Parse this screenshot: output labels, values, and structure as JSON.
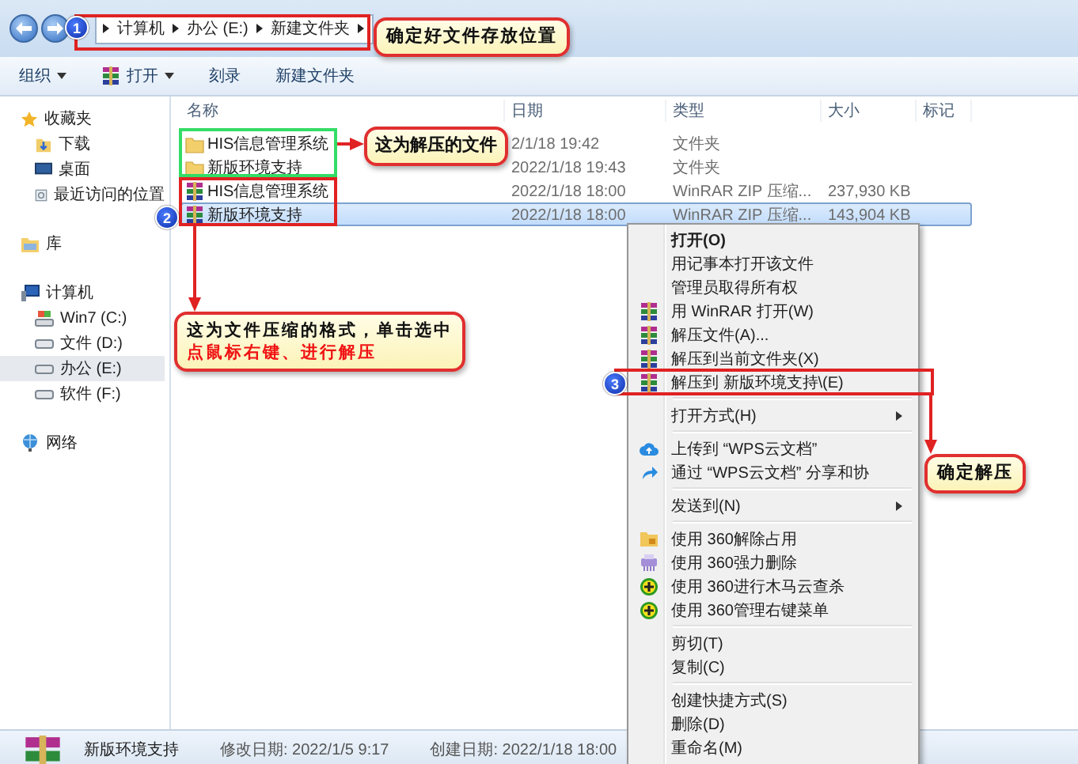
{
  "address_bar": {
    "path": [
      "计算机",
      "办公 (E:)",
      "新建文件夹"
    ]
  },
  "toolbar": [
    {
      "label": "组织",
      "dropdown": true
    },
    {
      "label": "打开",
      "dropdown": true
    },
    {
      "label": "刻录",
      "dropdown": false
    },
    {
      "label": "新建文件夹",
      "dropdown": false
    }
  ],
  "sidebar": {
    "items": [
      {
        "label": "收藏夹",
        "selected": false,
        "children": [
          {
            "label": "下载",
            "selected": false
          },
          {
            "label": "桌面",
            "selected": false
          },
          {
            "label": "最近访问的位置",
            "selected": false
          }
        ]
      },
      {
        "label": "库",
        "selected": false
      },
      {
        "label": "计算机",
        "selected": false,
        "children": [
          {
            "label": "Win7 (C:)",
            "selected": false
          },
          {
            "label": "文件 (D:)",
            "selected": false
          },
          {
            "label": "办公 (E:)",
            "selected": true
          },
          {
            "label": "软件 (F:)",
            "selected": false
          }
        ]
      },
      {
        "label": "网络",
        "selected": false
      }
    ]
  },
  "file_list": {
    "columns": [
      "名称",
      "日期",
      "类型",
      "大小",
      "标记"
    ],
    "rows": [
      {
        "name": "HIS信息管理系统",
        "kind": "folder",
        "date": "2/1/18 19:42",
        "type": "文件夹",
        "selected": false
      },
      {
        "name": "新版环境支持",
        "kind": "folder",
        "date": "2022/1/18 19:43",
        "type": "文件夹",
        "selected": false
      },
      {
        "name": "HIS信息管理系统",
        "kind": "archive",
        "date": "2022/1/18 18:00",
        "type": "WinRAR ZIP 压缩...",
        "size": "237,930 KB",
        "selected": false
      },
      {
        "name": "新版环境支持",
        "kind": "archive",
        "date": "2022/1/18 18:00",
        "type": "WinRAR ZIP 压缩...",
        "size": "143,904 KB",
        "selected": true
      }
    ]
  },
  "context_menu": {
    "groups": [
      [
        {
          "label": "打开(O)",
          "default": true,
          "submenu": false
        },
        {
          "label": "用记事本打开该文件",
          "default": false,
          "submenu": false
        },
        {
          "label": "管理员取得所有权",
          "default": false,
          "submenu": false
        },
        {
          "label": "用 WinRAR 打开(W)",
          "default": false,
          "submenu": false
        },
        {
          "label": "解压文件(A)...",
          "default": false,
          "submenu": false
        },
        {
          "label": "解压到当前文件夹(X)",
          "default": false,
          "submenu": false
        },
        {
          "label": "解压到 新版环境支持\\(E)",
          "default": false,
          "submenu": false
        }
      ],
      [
        {
          "label": "打开方式(H)",
          "default": false,
          "submenu": true
        }
      ],
      [
        {
          "label": "上传到 “WPS云文档”",
          "default": false,
          "submenu": false
        },
        {
          "label": "通过 “WPS云文档” 分享和协",
          "default": false
        }
      ],
      [
        {
          "label": "发送到(N)",
          "default": false,
          "submenu": true
        }
      ],
      [
        {
          "label": "使用 360解除占用",
          "default": false,
          "submenu": false
        },
        {
          "label": "使用 360强力删除",
          "default": false,
          "submenu": false
        },
        {
          "label": "使用 360进行木马云查杀",
          "default": false,
          "submenu": false
        },
        {
          "label": "使用 360管理右键菜单",
          "default": false,
          "submenu": false
        }
      ],
      [
        {
          "label": "剪切(T)",
          "default": false,
          "submenu": false
        },
        {
          "label": "复制(C)",
          "default": false,
          "submenu": false
        }
      ],
      [
        {
          "label": "创建快捷方式(S)",
          "default": false,
          "submenu": false
        },
        {
          "label": "删除(D)",
          "default": false,
          "submenu": false
        },
        {
          "label": "重命名(M)",
          "default": false,
          "submenu": false
        }
      ]
    ]
  },
  "details_pane": {
    "name": "新版环境支持",
    "modified": "修改日期: 2022/1/5 9:17",
    "created": "创建日期: 2022/1/18 18:00"
  },
  "annotations": {
    "badges": [
      "1",
      "2",
      "3"
    ],
    "callouts": [
      {
        "lines": [
          {
            "text": "确定好文件存放位置",
            "highlight": false
          }
        ]
      },
      {
        "lines": [
          {
            "text": "这为解压的文件",
            "highlight": false
          }
        ]
      },
      {
        "lines": [
          {
            "text": "这为文件压缩的格式，单击选中",
            "highlight": false
          },
          {
            "text": "点鼠标右键、进行解压",
            "highlight": true
          }
        ]
      },
      {
        "lines": [
          {
            "text": "确定解压",
            "highlight": false
          }
        ]
      }
    ]
  }
}
